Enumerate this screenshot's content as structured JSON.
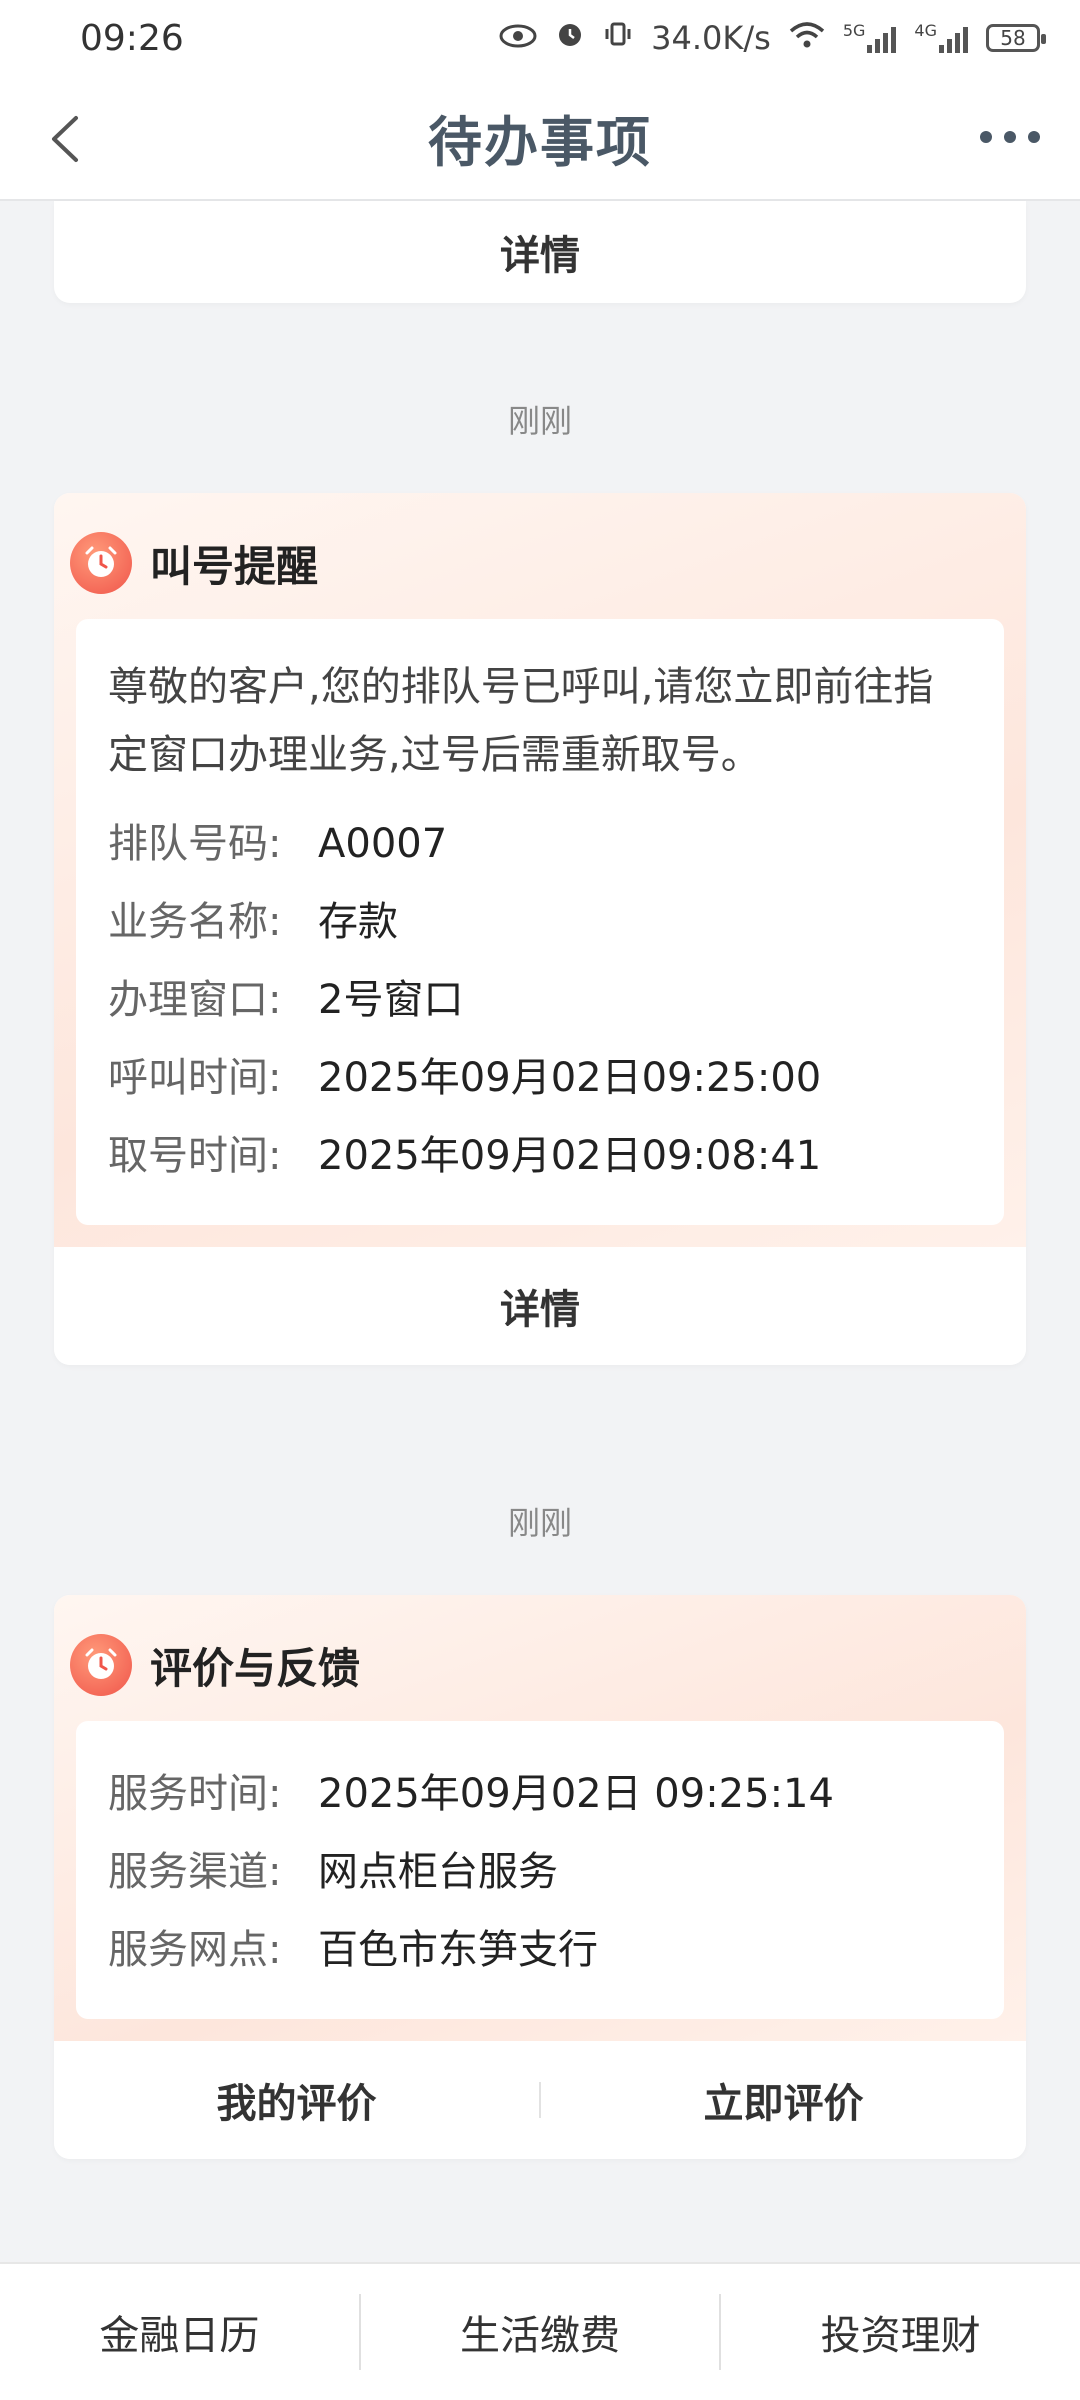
{
  "status_bar": {
    "time": "09:26",
    "net_speed": "34.0K/s",
    "sig1_label": "5G",
    "sig2_label": "4G",
    "battery": "58"
  },
  "nav": {
    "title": "待办事项"
  },
  "top_card": {
    "detail_label": "详情"
  },
  "card1": {
    "timestamp": "刚刚",
    "title": "叫号提醒",
    "message": "尊敬的客户,您的排队号已呼叫,请您立即前往指定窗口办理业务,过号后需重新取号。",
    "fields": [
      {
        "key": "排队号码:",
        "value": "A0007"
      },
      {
        "key": "业务名称:",
        "value": "存款"
      },
      {
        "key": "办理窗口:",
        "value": "2号窗口"
      },
      {
        "key": "呼叫时间:",
        "value": "2025年09月02日09:25:00"
      },
      {
        "key": "取号时间:",
        "value": "2025年09月02日09:08:41"
      }
    ],
    "detail_label": "详情"
  },
  "card2": {
    "timestamp": "刚刚",
    "title": "评价与反馈",
    "fields": [
      {
        "key": "服务时间:",
        "value": "2025年09月02日 09:25:14"
      },
      {
        "key": "服务渠道:",
        "value": "网点柜台服务"
      },
      {
        "key": "服务网点:",
        "value": "百色市东笋支行"
      }
    ],
    "my_review_label": "我的评价",
    "review_now_label": "立即评价"
  },
  "tab_bar": {
    "items": [
      {
        "label": "金融日历"
      },
      {
        "label": "生活缴费"
      },
      {
        "label": "投资理财"
      }
    ]
  },
  "colors": {
    "nav_title": "#4a5866",
    "card_header_tint": "#fde6dc",
    "alarm_icon": "#f0554a",
    "background": "#f2f3f5"
  }
}
